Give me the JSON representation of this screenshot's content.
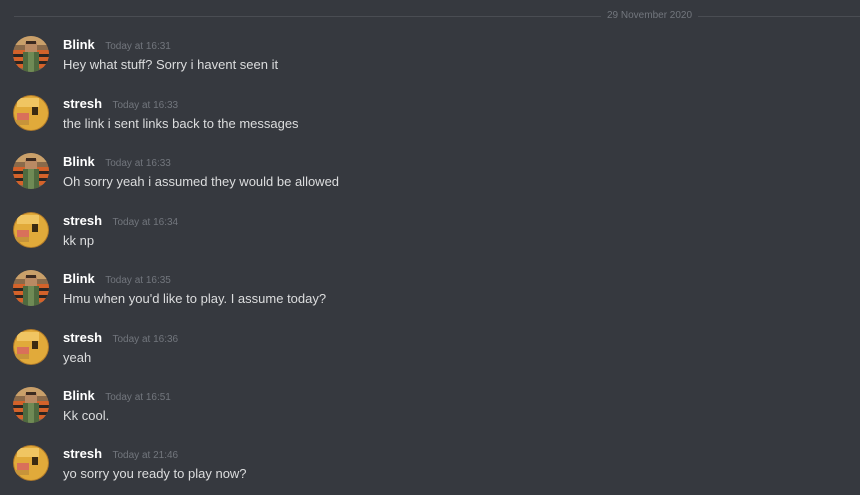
{
  "date_divider": "29 November 2020",
  "messages": [
    {
      "author": "Blink",
      "avatar": "blink-avatar-icon",
      "time": "Today at 16:31",
      "text": "Hey what stuff? Sorry i havent seen it"
    },
    {
      "author": "stresh",
      "avatar": "stresh-avatar-icon",
      "time": "Today at 16:33",
      "text": "the link i sent links back to the messages"
    },
    {
      "author": "Blink",
      "avatar": "blink-avatar-icon",
      "time": "Today at 16:33",
      "text": "Oh sorry yeah i assumed they would be allowed"
    },
    {
      "author": "stresh",
      "avatar": "stresh-avatar-icon",
      "time": "Today at 16:34",
      "text": "kk np"
    },
    {
      "author": "Blink",
      "avatar": "blink-avatar-icon",
      "time": "Today at 16:35",
      "text": "Hmu when you'd like to play. I assume today?"
    },
    {
      "author": "stresh",
      "avatar": "stresh-avatar-icon",
      "time": "Today at 16:36",
      "text": "yeah"
    },
    {
      "author": "Blink",
      "avatar": "blink-avatar-icon",
      "time": "Today at 16:51",
      "text": "Kk cool."
    },
    {
      "author": "stresh",
      "avatar": "stresh-avatar-icon",
      "time": "Today at 21:46",
      "text": "yo sorry you ready to play now?"
    }
  ],
  "colors": {
    "background": "#36393f",
    "username": "#ffffff",
    "message_text": "#dcddde",
    "timestamp": "#72767d",
    "divider": "#4a4d53"
  }
}
